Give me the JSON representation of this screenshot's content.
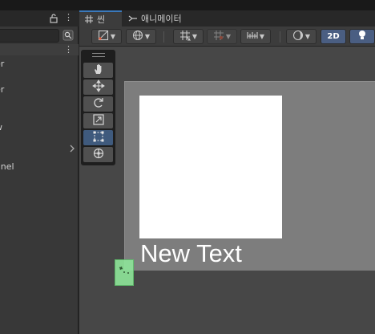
{
  "scene_tabs": [
    {
      "label": "씬",
      "icon": "grid-icon",
      "active": true
    },
    {
      "label": "애니메이터",
      "icon": "animator-icon",
      "active": false
    }
  ],
  "hierarchy": {
    "items": [
      {
        "label": "er"
      },
      {
        "label": "er"
      },
      {
        "label": "w"
      },
      {
        "label": "anel"
      }
    ]
  },
  "toolbar": {
    "mode_2d_label": "2D"
  },
  "scene": {
    "text_object": "New Text"
  },
  "tools": [
    {
      "name": "hand-tool",
      "icon": "hand-icon",
      "active": false
    },
    {
      "name": "move-tool",
      "icon": "move-icon",
      "active": false
    },
    {
      "name": "rotate-tool",
      "icon": "rotate-icon",
      "active": false
    },
    {
      "name": "scale-tool",
      "icon": "scale-icon",
      "active": false
    },
    {
      "name": "rect-tool",
      "icon": "rect-tool-icon",
      "active": true
    },
    {
      "name": "transform-tool",
      "icon": "transform-icon",
      "active": false
    }
  ],
  "colors": {
    "accent": "#3a79bb",
    "active_tool": "#3f5a7d",
    "canvas": "#7d7d7d",
    "image": "#ffffff",
    "gizmo_green": "#8ee69a"
  }
}
